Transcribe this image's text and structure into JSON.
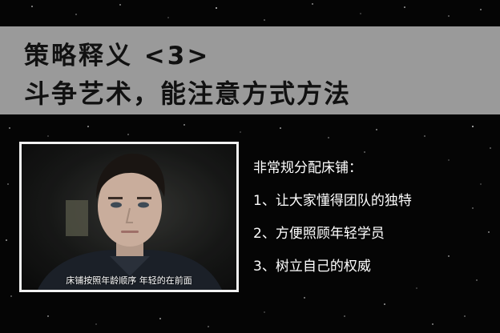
{
  "slide": {
    "title_line1": "策略释义 <3>",
    "title_line2": "斗争艺术，能注意方式方法",
    "image_caption": "床铺按照年龄顺序  年轻的在前面",
    "points": [
      "非常规分配床铺：",
      "1、让大家懂得团队的独特",
      "2、方便照顾年轻学员",
      "3、树立自己的权威"
    ]
  },
  "colors": {
    "background": "#050505",
    "banner": "#9a9a9a",
    "title_text": "#111111",
    "body_text": "#ffffff",
    "frame": "#f2f2f2"
  }
}
